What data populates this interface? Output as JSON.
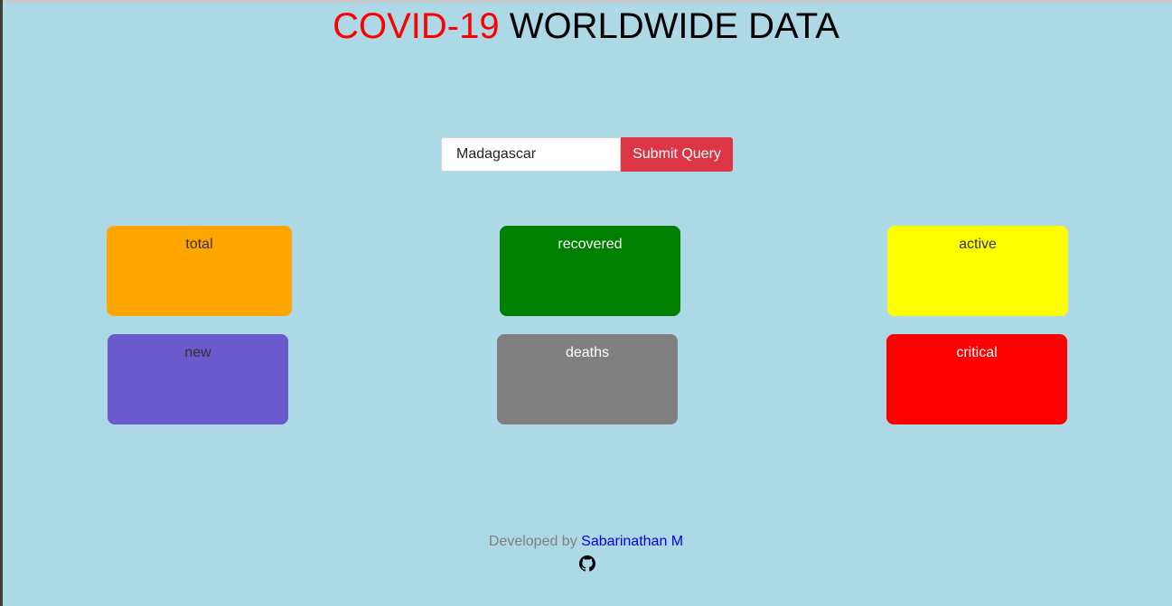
{
  "header": {
    "title_highlight": "COVID-19",
    "title_rest": "WORLDWIDE DATA",
    "highlight_color": "#ff0000"
  },
  "search": {
    "value": "Madagascar",
    "placeholder": "",
    "submit_label": "Submit Query",
    "submit_color": "#dc3545"
  },
  "cards": [
    {
      "key": "total",
      "label": "total",
      "value": "",
      "color": "#ffa500",
      "text_color": "#333333"
    },
    {
      "key": "recovered",
      "label": "recovered",
      "value": "",
      "color": "#008000",
      "text_color": "#ffffff"
    },
    {
      "key": "active",
      "label": "active",
      "value": "",
      "color": "#ffff00",
      "text_color": "#333333"
    },
    {
      "key": "new",
      "label": "new",
      "value": "",
      "color": "#6a5acd",
      "text_color": "#333333"
    },
    {
      "key": "deaths",
      "label": "deaths",
      "value": "",
      "color": "#808080",
      "text_color": "#ffffff"
    },
    {
      "key": "critical",
      "label": "critical",
      "value": "",
      "color": "#ff0000",
      "text_color": "#ffffff"
    }
  ],
  "footer": {
    "developed_by": "Developed by",
    "author": "Sabarinathan M",
    "github_icon": "github-icon"
  }
}
